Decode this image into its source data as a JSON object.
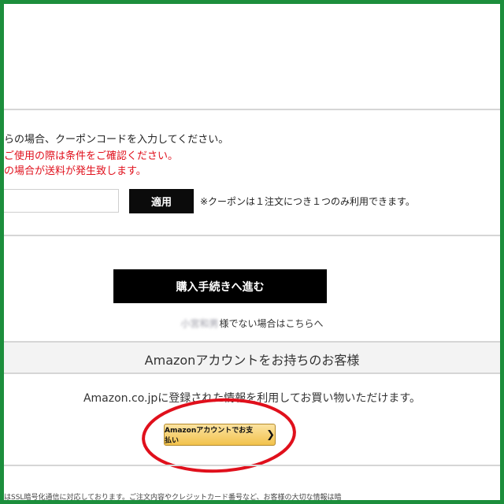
{
  "coupon": {
    "line1": "らの場合、クーポンコードを入力してください。",
    "line2": "ご使用の際は条件をご確認ください。",
    "line3": "の場合が送料が発生致します。",
    "input_value": "",
    "apply_label": "適用",
    "note": "※クーポンは１注文につき１つのみ利用できます。"
  },
  "checkout": {
    "button_label": "購入手続きへ進む",
    "user_name": "小宮和男",
    "not_user_text": "様でない場合はこちらへ"
  },
  "amazon": {
    "section_title": "Amazonアカウントをお持ちのお客様",
    "description": "Amazon.co.jpに登録された情報を利用してお買い物いただけます。",
    "pay_button_label": "Amazonアカウントでお支払い",
    "pay_button_chevron": "❯"
  },
  "footer": {
    "ssl_note": "はSSL暗号化通信に対応しております。ご注文内容やクレジットカード番号など、お客様の大切な情報は暗"
  },
  "colors": {
    "frame_border": "#1c8e3c",
    "warning_text": "#e0101c",
    "annotation_circle": "#e0101c",
    "pay_button": "#f2c24c"
  }
}
